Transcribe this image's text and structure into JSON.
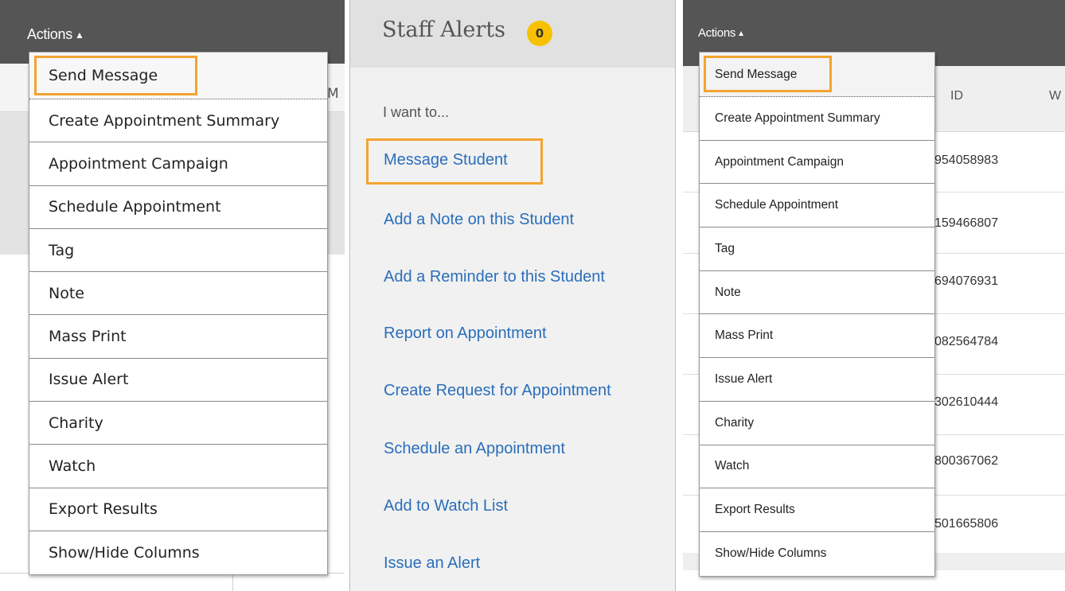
{
  "panel_left": {
    "actions_label": "Actions",
    "caret": "▲",
    "partial_header": "M",
    "menu": [
      "Send Message",
      "Create Appointment Summary",
      "Appointment Campaign",
      "Schedule Appointment",
      "Tag",
      "Note",
      "Mass Print",
      "Issue Alert",
      "Charity",
      "Watch",
      "Export Results",
      "Show/Hide Columns"
    ]
  },
  "panel_middle": {
    "title": "Staff Alerts",
    "badge_count": "0",
    "subtitle": "I want to...",
    "links": [
      "Message Student",
      "Add a Note on this Student",
      "Add a Reminder to this Student",
      "Report on Appointment",
      "Create Request for Appointment",
      "Schedule an Appointment",
      "Add to Watch List",
      "Issue an Alert"
    ]
  },
  "panel_right": {
    "actions_label": "Actions",
    "caret": "▲",
    "column_headers": [
      "ID",
      "W"
    ],
    "ids": [
      "954058983",
      "159466807",
      "694076931",
      "082564784",
      "302610444",
      "800367062",
      "501665806"
    ],
    "menu": [
      "Send Message",
      "Create Appointment Summary",
      "Appointment Campaign",
      "Schedule Appointment",
      "Tag",
      "Note",
      "Mass Print",
      "Issue Alert",
      "Charity",
      "Watch",
      "Export Results",
      "Show/Hide Columns"
    ]
  },
  "colors": {
    "highlight": "#f4a331",
    "link": "#2a6ebb",
    "badge": "#f7c100",
    "toolbar": "#555555"
  }
}
